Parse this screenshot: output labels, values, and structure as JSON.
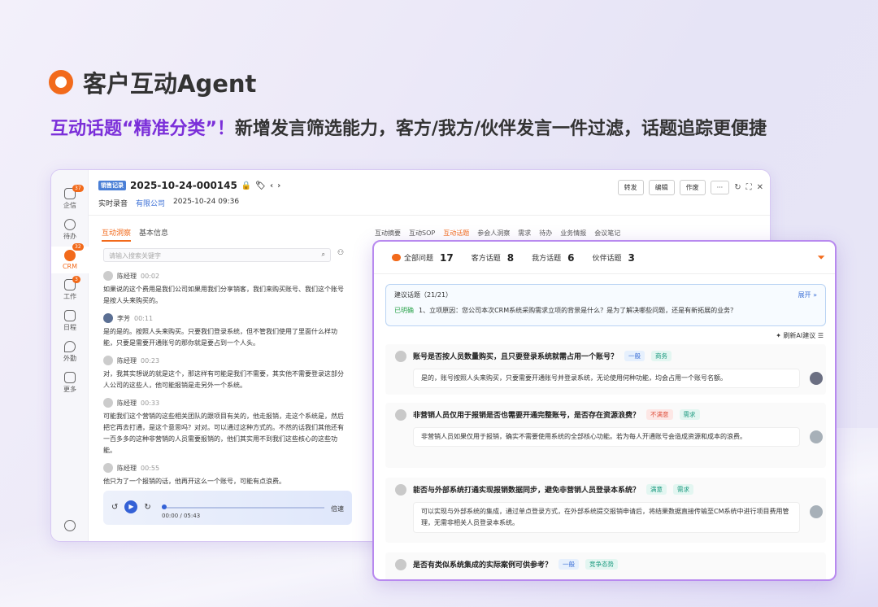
{
  "banner": {
    "title": "客户互动Agent",
    "headline_highlight": "互动话题“精准分类”！",
    "headline_rest": "新增发言筛选能力，客方/我方/伙伴发言一件过滤，话题追踪更便捷"
  },
  "sidebar": {
    "items": [
      {
        "label": "企信",
        "badge": "37"
      },
      {
        "label": "待办",
        "badge": ""
      },
      {
        "label": "CRM",
        "badge": "32"
      },
      {
        "label": "工作",
        "badge": "3"
      },
      {
        "label": "日程",
        "badge": ""
      },
      {
        "label": "外勤",
        "badge": ""
      },
      {
        "label": "更多",
        "badge": ""
      }
    ]
  },
  "header": {
    "tag": "销售记录",
    "record_id": "2025-10-24-000145",
    "type": "实时录音",
    "company": "有限公司",
    "datetime": "2025-10-24 09:36",
    "buttons": [
      "转发",
      "编辑",
      "作废"
    ]
  },
  "left": {
    "tabs": [
      "互动洞察",
      "基本信息"
    ],
    "search_placeholder": "请输入搜索关键字",
    "messages": [
      {
        "name": "陈经理",
        "time": "00:02",
        "text": "如果说的这个费用是我们公司如果用我们分享销客，我们来购买账号、我们这个账号是按人头来购买的。"
      },
      {
        "name": "李芳",
        "time": "00:11",
        "text": "是的是的。按照人头来购买。只要我们登录系统，但不管我们使用了里面什么样功能，只要是需要开通账号的那你就是要占到一个人头。"
      },
      {
        "name": "陈经理",
        "time": "00:23",
        "text": "对，我其实想说的就是这个，那这样有可能是我们不需要，其实他不需要登录这部分人公司的这些人，他可能报销是走另外一个系统。"
      },
      {
        "name": "陈经理",
        "time": "00:33",
        "text": "可能我们这个营销的这些相关团队的跟项目有关的，他走报销，走这个系统是，然后把它再去打通，是这个意思吗？对对。可以通过这种方式的。不然的话我们其他还有一百多多的这种非营销的人员需要报销的，他们其实用不到我们这些核心的这些功能。"
      },
      {
        "name": "陈经理",
        "time": "00:55",
        "text": "他只为了一个报销的话，他再开这么一个账号，可能有点浪费。"
      }
    ],
    "player": {
      "time": "00:00 / 05:43",
      "speed": "倍速"
    }
  },
  "right_tabs": [
    "互动摘要",
    "互动SOP",
    "互动话题",
    "参会人洞察",
    "需求",
    "待办",
    "业务情报",
    "会议笔记"
  ],
  "panel": {
    "filters": [
      {
        "label": "全部问题",
        "count": "17"
      },
      {
        "label": "客方话题",
        "count": "8"
      },
      {
        "label": "我方话题",
        "count": "6"
      },
      {
        "label": "伙伴话题",
        "count": "3"
      }
    ],
    "suggest": {
      "title": "建议话题（21/21）",
      "expand": "展开",
      "status": "已明确",
      "text": "1、立项原因：您公司本次CRM系统采购需求立项的背景是什么？是为了解决哪些问题，还是有新拓展的业务？"
    },
    "refresh": "刷新AI建议",
    "questions": [
      {
        "q": "账号是否按人员数量购买，且只要登录系统就需占用一个账号？",
        "tags": [
          "一般",
          "商务"
        ],
        "a": "是的，账号按照人头来购买，只要需要开通账号并登录系统，无论使用何种功能，均会占用一个账号名额。"
      },
      {
        "q": "非营销人员仅用于报销是否也需要开通完整账号，是否存在资源浪费？",
        "tags": [
          "不满意",
          "需求"
        ],
        "a": "非营销人员如果仅用于报销，确实不需要使用系统的全部核心功能。若为每人开通账号会造成资源和成本的浪费。"
      },
      {
        "q": "能否与外部系统打通实现报销数据同步，避免非营销人员登录本系统？",
        "tags": [
          "满意",
          "需求"
        ],
        "a": "可以实现与外部系统的集成，通过单点登录方式，在外部系统提交报销申请后，将结果数据直接传输至CM系统中进行项目费用管理，无需非相关人员登录本系统。"
      },
      {
        "q": "是否有类似系统集成的实际案例可供参考？",
        "tags": [
          "一般",
          "竞争态势"
        ],
        "a": ""
      }
    ]
  }
}
